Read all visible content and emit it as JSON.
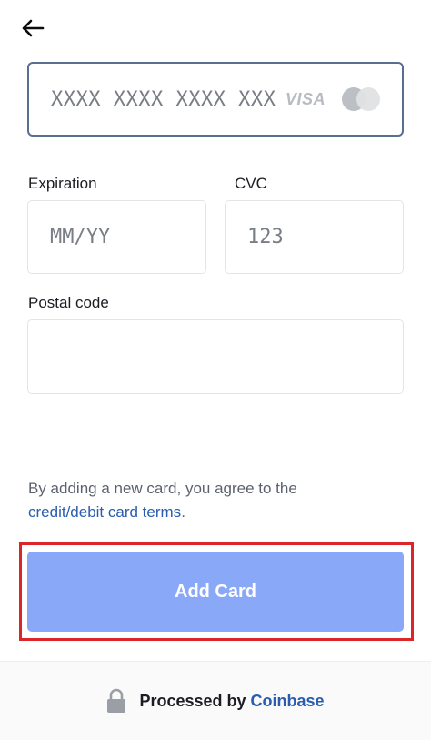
{
  "header": {
    "back_icon": "arrow-left-icon"
  },
  "card": {
    "number_placeholder": "XXXX XXXX XXXX XXXX",
    "visa_label": "VISA",
    "mastercard_icon": "mastercard-icon"
  },
  "expiration": {
    "label": "Expiration",
    "placeholder": "MM/YY"
  },
  "cvc": {
    "label": "CVC",
    "placeholder": "123"
  },
  "postal": {
    "label": "Postal code",
    "placeholder": ""
  },
  "terms": {
    "text": "By adding a new card, you agree to the",
    "link": "credit/debit card terms",
    "suffix": "."
  },
  "add_button": {
    "label": "Add Card",
    "color": "#8aa8f8"
  },
  "footer": {
    "lock_icon": "lock-icon",
    "prefix": "Processed by",
    "brand": "Coinbase",
    "brand_color": "#2a5db0"
  },
  "highlight_color": "#d9262b"
}
